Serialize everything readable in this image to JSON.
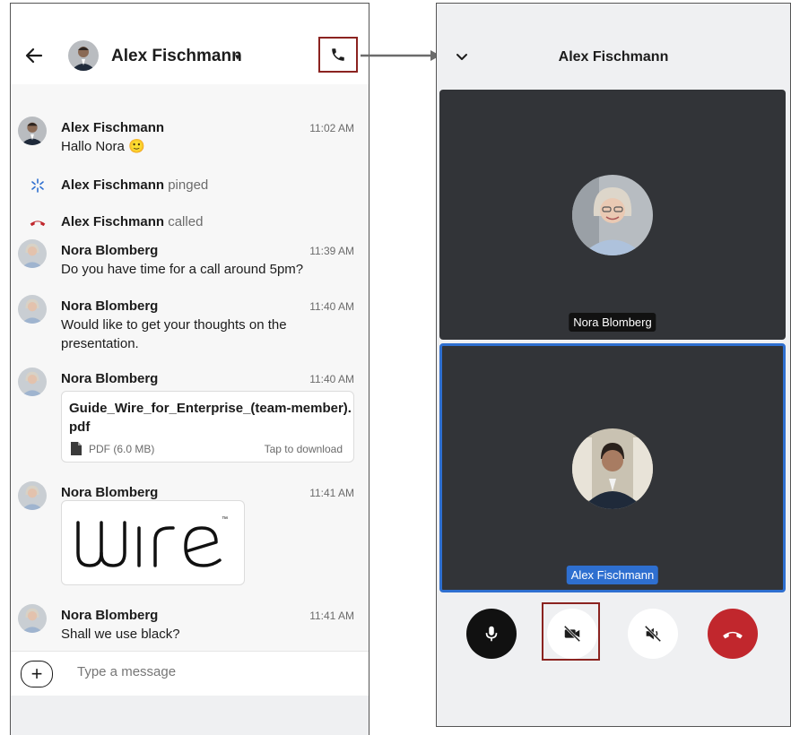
{
  "chat": {
    "header": {
      "contact_name": "Alex Fischmann",
      "caret": "▾",
      "back_icon": "arrow-left-icon",
      "call_icon": "phone-icon"
    },
    "messages": [
      {
        "type": "text",
        "sender": "Alex Fischmann",
        "time": "11:02 AM",
        "text": "Hallo Nora 🙂"
      },
      {
        "type": "system",
        "icon": "ping-icon",
        "name": "Alex Fischmann",
        "action": "pinged"
      },
      {
        "type": "system",
        "icon": "missed-call-icon",
        "name": "Alex Fischmann",
        "action": "called"
      },
      {
        "type": "text",
        "sender": "Nora Blomberg",
        "time": "11:39 AM",
        "text": "Do you have time for a call around 5pm?"
      },
      {
        "type": "text",
        "sender": "Nora Blomberg",
        "time": "11:40 AM",
        "text": "Would like to get your thoughts on the presentation."
      },
      {
        "type": "file",
        "sender": "Nora Blomberg",
        "time": "11:40 AM",
        "file_name": "Guide_Wire_for_Enterprise_(team-member).pdf",
        "file_meta": "PDF (6.0 MB)",
        "file_action": "Tap to download"
      },
      {
        "type": "image",
        "sender": "Nora Blomberg",
        "time": "11:41 AM",
        "image": "wire-logo"
      },
      {
        "type": "text",
        "sender": "Nora Blomberg",
        "time": "11:41 AM",
        "text": "Shall we use black?"
      }
    ],
    "composer": {
      "plus_label": "+",
      "placeholder": "Type a message"
    }
  },
  "call": {
    "title": "Alex Fischmann",
    "minimize_icon": "chevron-down-icon",
    "participants": [
      {
        "name": "Nora Blomberg"
      },
      {
        "name": "Alex Fischmann",
        "active": true
      }
    ],
    "controls": [
      {
        "icon": "microphone-icon",
        "state": "on"
      },
      {
        "icon": "camera-off-icon",
        "state": "off"
      },
      {
        "icon": "speaker-muted-icon",
        "state": "off"
      },
      {
        "icon": "hang-up-icon",
        "state": "end"
      }
    ]
  },
  "colors": {
    "highlight": "#8b2320",
    "accent": "#2e6fd0",
    "hangup": "#c1272d",
    "tile": "#323438"
  }
}
